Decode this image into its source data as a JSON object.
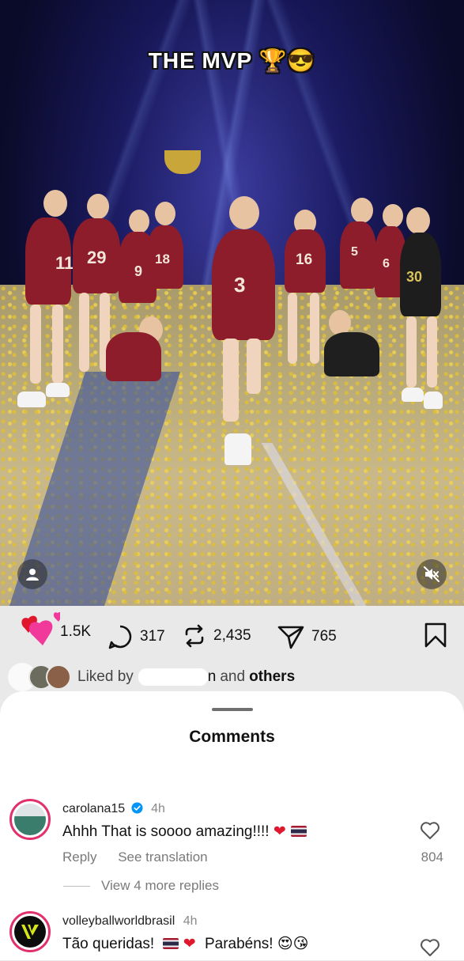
{
  "video": {
    "caption": "THE MVP 🏆😎",
    "jersey_numbers": [
      "11",
      "29",
      "9",
      "18",
      "3",
      "16",
      "5",
      "6",
      "30"
    ]
  },
  "actions": {
    "likes_count": "1.5K",
    "comments_count": "317",
    "reposts_count": "2,435",
    "shares_count": "765"
  },
  "liked_by": {
    "prefix": "Liked by",
    "user_suffix": "n",
    "and_label": "and",
    "others_label": "others"
  },
  "comments_sheet": {
    "title": "Comments",
    "comments": [
      {
        "username": "carolana15",
        "time": "4h",
        "text": "Ahhh That is soooo amazing!!!!",
        "reply_label": "Reply",
        "translate_label": "See translation",
        "like_count": "804",
        "view_replies_label": "View 4 more replies"
      },
      {
        "username": "volleyballworldbrasil",
        "time": "4h",
        "text_part1": "Tão queridas!",
        "text_part2": "Parabéns!",
        "emoji_end": "😍😘"
      }
    ]
  },
  "colors": {
    "like_pink": "#f0399a",
    "verified_blue": "#0095f6",
    "sheet_bg": "#ffffff",
    "page_bg": "#e9e9ea"
  }
}
